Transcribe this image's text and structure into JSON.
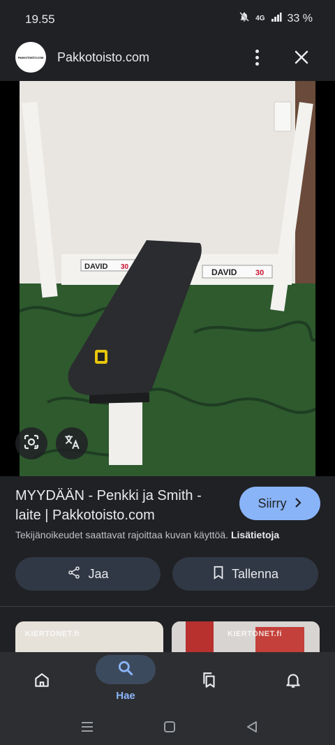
{
  "status_bar": {
    "time": "19.55",
    "network": "4G",
    "battery": "33 %"
  },
  "header": {
    "logo_text": "PAKKOTOISTO.COM",
    "site_name": "Pakkotoisto.com"
  },
  "image": {
    "sign_text": "DAVID",
    "sign_number": "30",
    "watermark": "KIERTONET.fi"
  },
  "result": {
    "title": "MYYDÄÄN - Penkki ja Smith -laite | Pakkotoisto.com",
    "visit_label": "Siirry",
    "copyright": "Tekijänoikeudet saattavat rajoittaa kuvan käyttöä.",
    "learn_more": "Lisätietoja"
  },
  "actions": {
    "share_label": "Jaa",
    "save_label": "Tallenna"
  },
  "bottom_nav": {
    "search_label": "Hae"
  },
  "colors": {
    "background": "#202124",
    "accent": "#8ab4f8",
    "button_bg": "#303845",
    "nav_bg": "#2d2e31"
  },
  "icons": [
    "bell-muted-icon",
    "signal-icon",
    "more-vert-icon",
    "close-icon",
    "lens-icon",
    "translate-icon",
    "chevron-right-icon",
    "share-icon",
    "bookmark-icon",
    "home-icon",
    "search-icon",
    "collections-icon",
    "notifications-icon",
    "recents-icon",
    "home-system-icon",
    "back-icon"
  ]
}
